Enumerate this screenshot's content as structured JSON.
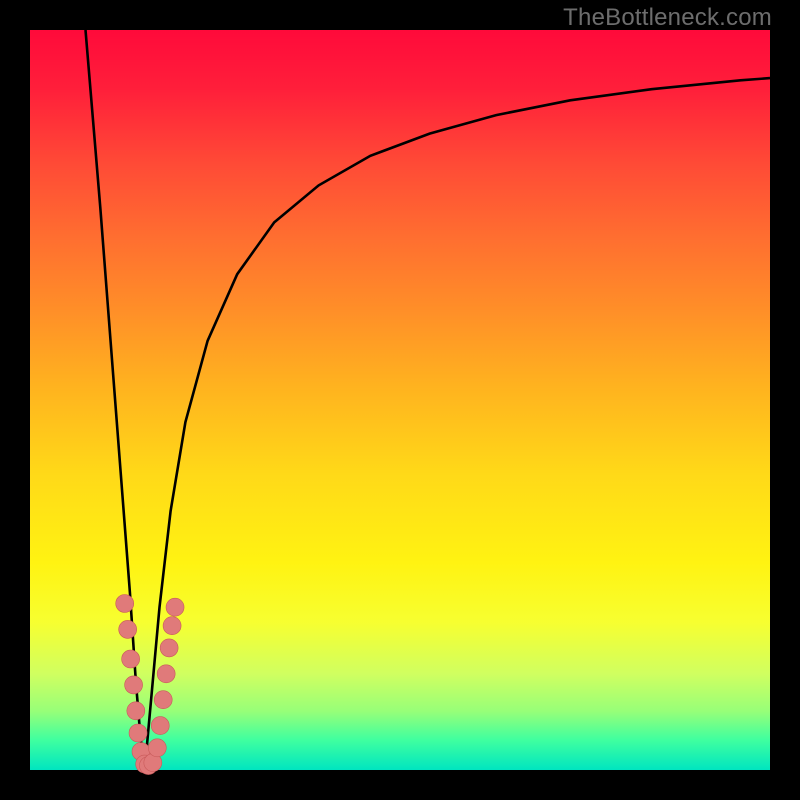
{
  "watermark": "TheBottleneck.com",
  "chart_data": {
    "type": "line",
    "title": "",
    "xlabel": "",
    "ylabel": "",
    "xlim": [
      0,
      100
    ],
    "ylim": [
      0,
      100
    ],
    "background_gradient": {
      "top_color": "#ff0a3a",
      "bottom_color": "#00e5c0",
      "meaning": "red=high bottleneck, green=low bottleneck"
    },
    "series": [
      {
        "name": "left-branch",
        "x": [
          7.5,
          8.5,
          9.5,
          10.5,
          11.5,
          12.5,
          13.5,
          14.3,
          14.8,
          15.2,
          15.5
        ],
        "y": [
          100,
          88,
          76,
          63,
          50,
          37,
          24,
          12,
          6,
          2,
          0
        ]
      },
      {
        "name": "right-branch",
        "x": [
          15.5,
          16.5,
          17.5,
          19.0,
          21.0,
          24.0,
          28.0,
          33.0,
          39.0,
          46.0,
          54.0,
          63.0,
          73.0,
          84.0,
          96.0,
          100.0
        ],
        "y": [
          0,
          11,
          22,
          35,
          47,
          58,
          67,
          74,
          79,
          83,
          86,
          88.5,
          90.5,
          92,
          93.2,
          93.5
        ]
      }
    ],
    "scatter": {
      "name": "data-points",
      "points": [
        {
          "x": 12.8,
          "y": 22.5
        },
        {
          "x": 13.2,
          "y": 19.0
        },
        {
          "x": 13.6,
          "y": 15.0
        },
        {
          "x": 14.0,
          "y": 11.5
        },
        {
          "x": 14.3,
          "y": 8.0
        },
        {
          "x": 14.6,
          "y": 5.0
        },
        {
          "x": 15.0,
          "y": 2.5
        },
        {
          "x": 15.5,
          "y": 0.8
        },
        {
          "x": 16.0,
          "y": 0.6
        },
        {
          "x": 16.6,
          "y": 1.0
        },
        {
          "x": 17.2,
          "y": 3.0
        },
        {
          "x": 17.6,
          "y": 6.0
        },
        {
          "x": 18.0,
          "y": 9.5
        },
        {
          "x": 18.4,
          "y": 13.0
        },
        {
          "x": 18.8,
          "y": 16.5
        },
        {
          "x": 19.2,
          "y": 19.5
        },
        {
          "x": 19.6,
          "y": 22.0
        }
      ]
    }
  }
}
